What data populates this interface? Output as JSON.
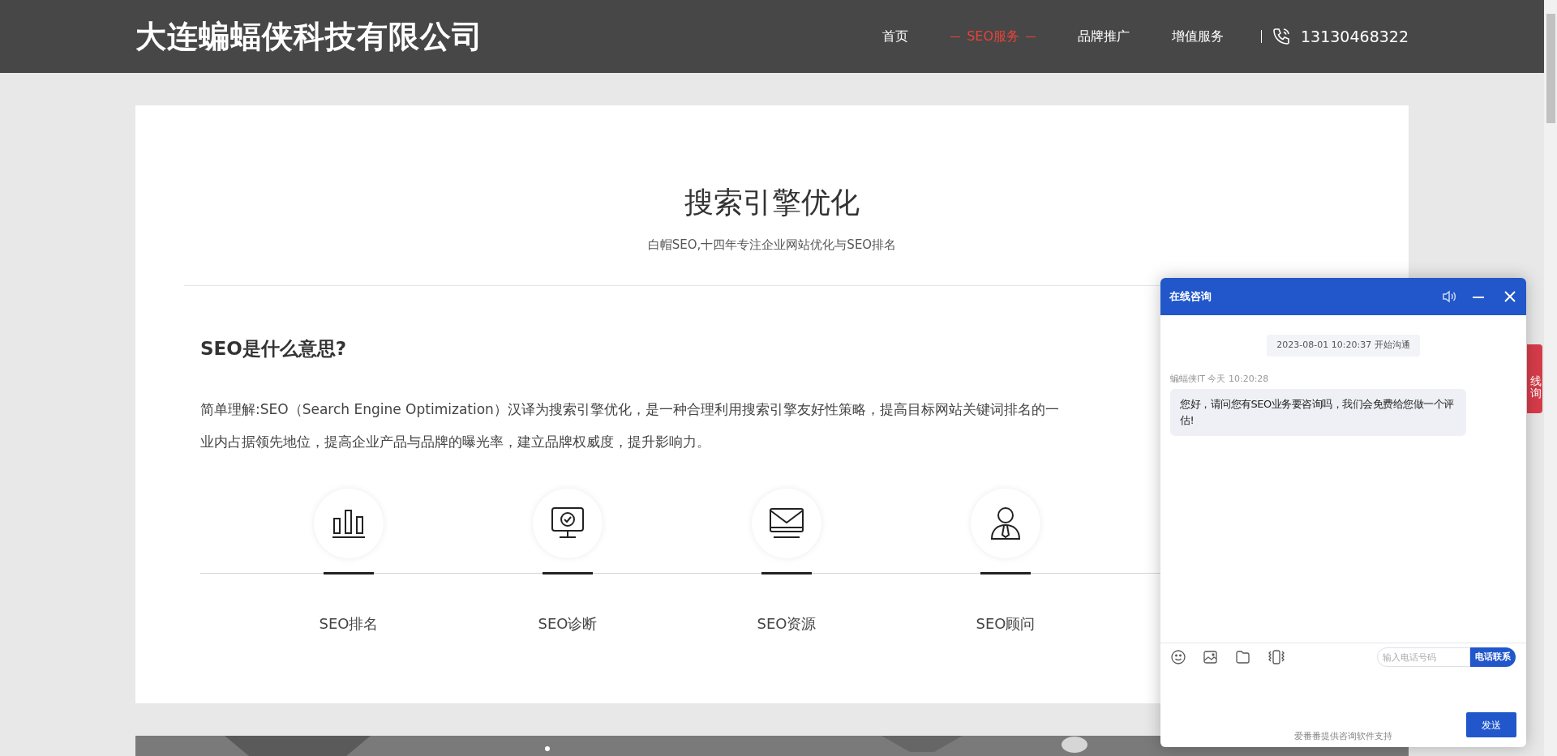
{
  "header": {
    "logo": "大连蝙蝠侠科技有限公司",
    "nav": [
      {
        "label": "首页",
        "selected": false
      },
      {
        "label": "SEO服务",
        "selected": true
      },
      {
        "label": "品牌推广",
        "selected": false
      },
      {
        "label": "增值服务",
        "selected": false
      }
    ],
    "phone": "13130468322"
  },
  "section": {
    "title": "搜索引擎优化",
    "subtitle": "白帽SEO,十四年专注企业网站优化与SEO排名",
    "heading": "SEO是什么意思?",
    "paragraph_lines": [
      "简单理解:SEO（Search Engine Optimization）汉译为搜索引擎优化，是一种合理利用搜索引擎友好性策略，提高目标网站关键词排名的一",
      "业内占据领先地位，提高企业产品与品牌的曝光率，建立品牌权威度，提升影响力。"
    ],
    "features": [
      {
        "kind": "chart",
        "label": "SEO排名"
      },
      {
        "kind": "monitor",
        "label": "SEO诊断"
      },
      {
        "kind": "mail",
        "label": "SEO资源"
      },
      {
        "kind": "person",
        "label": "SEO顾问"
      }
    ]
  },
  "side_tab": {
    "label": "线询"
  },
  "chat": {
    "title": "在线咨询",
    "started": "2023-08-01 10:20:37 开始沟通",
    "messages": [
      {
        "sender": "蝙蝠侠IT 今天 10:20:28",
        "text": "您好，请问您有SEO业务要咨询吗，我们会免费给您做一个评估!"
      }
    ],
    "phone_placeholder": "输入电话号码",
    "call_button": "电话联系",
    "send_button": "发送",
    "footer": "爱番番提供咨询软件支持"
  }
}
